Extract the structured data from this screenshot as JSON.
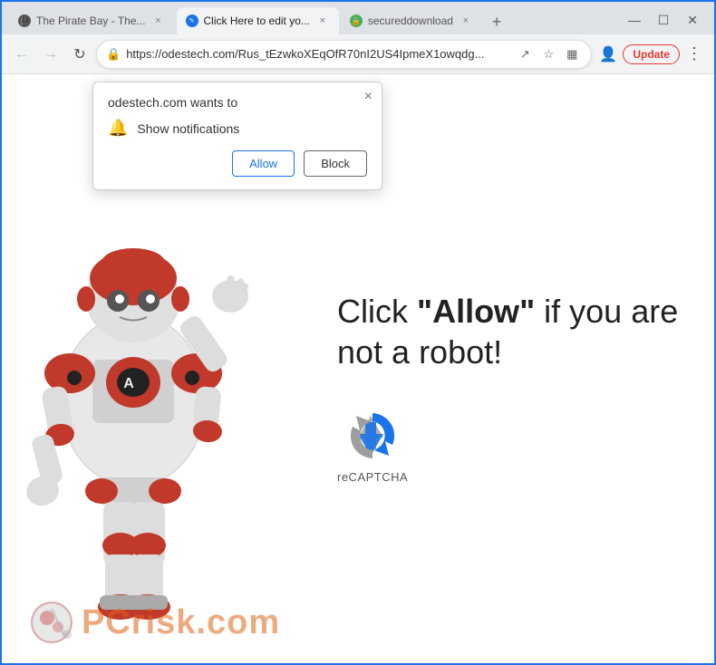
{
  "browser": {
    "tabs": [
      {
        "id": "tab-pirate",
        "title": "The Pirate Bay - The...",
        "favicon": "🏴",
        "active": false,
        "favicon_type": "pirate"
      },
      {
        "id": "tab-edit",
        "title": "Click Here to edit yo...",
        "favicon": "✎",
        "active": true,
        "favicon_type": "edit"
      },
      {
        "id": "tab-secure",
        "title": "secureddownload",
        "favicon": "🔒",
        "active": false,
        "favicon_type": "secure"
      }
    ],
    "tab_close_label": "×",
    "tab_add_label": "+",
    "window_controls": {
      "minimize": "—",
      "maximize": "☐",
      "close": "✕"
    },
    "address": "https://odestech.com/Rus_tEzwkoXEqOfR70nI2US4IpmeX1owqdg...",
    "update_button": "Update"
  },
  "notification_popup": {
    "title": "odestech.com wants to",
    "notification_text": "Show notifications",
    "allow_label": "Allow",
    "block_label": "Block",
    "close_label": "×"
  },
  "page": {
    "main_text_prefix": "Click ",
    "main_text_bold": "\"Allow\"",
    "main_text_suffix": " if you are not a robot!",
    "recaptcha_label": "reCAPTCHA"
  },
  "watermark": {
    "text_gray": "PC",
    "text_orange": "risk.com"
  },
  "colors": {
    "accent_blue": "#1a73e8",
    "tab_active_bg": "#f1f3f4",
    "tab_inactive_bg": "#dee1e6",
    "update_red": "#e53935"
  },
  "icons": {
    "back": "←",
    "forward": "→",
    "refresh": "↻",
    "lock": "🔒",
    "share": "↗",
    "star": "☆",
    "sidebar": "▦",
    "profile": "👤",
    "menu": "⋮",
    "bell": "🔔"
  }
}
